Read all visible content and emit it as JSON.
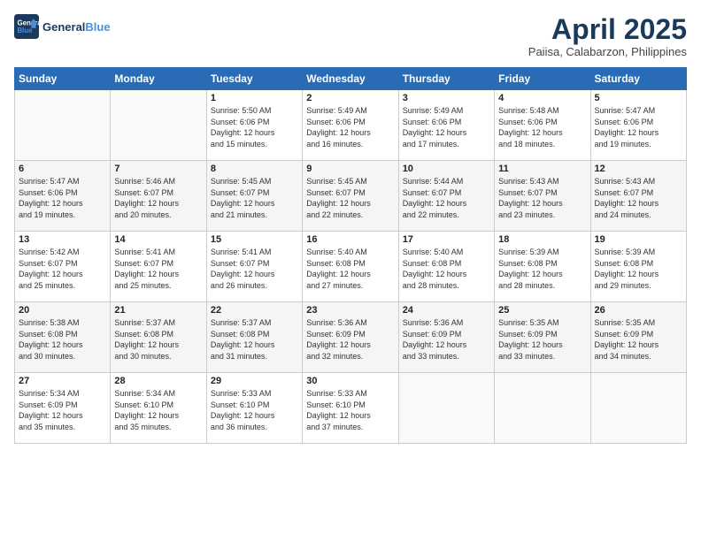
{
  "header": {
    "logo_line1": "General",
    "logo_line2": "Blue",
    "month_title": "April 2025",
    "subtitle": "Paiisa, Calabarzon, Philippines"
  },
  "days_of_week": [
    "Sunday",
    "Monday",
    "Tuesday",
    "Wednesday",
    "Thursday",
    "Friday",
    "Saturday"
  ],
  "weeks": [
    [
      {
        "day": "",
        "info": ""
      },
      {
        "day": "",
        "info": ""
      },
      {
        "day": "1",
        "info": "Sunrise: 5:50 AM\nSunset: 6:06 PM\nDaylight: 12 hours\nand 15 minutes."
      },
      {
        "day": "2",
        "info": "Sunrise: 5:49 AM\nSunset: 6:06 PM\nDaylight: 12 hours\nand 16 minutes."
      },
      {
        "day": "3",
        "info": "Sunrise: 5:49 AM\nSunset: 6:06 PM\nDaylight: 12 hours\nand 17 minutes."
      },
      {
        "day": "4",
        "info": "Sunrise: 5:48 AM\nSunset: 6:06 PM\nDaylight: 12 hours\nand 18 minutes."
      },
      {
        "day": "5",
        "info": "Sunrise: 5:47 AM\nSunset: 6:06 PM\nDaylight: 12 hours\nand 19 minutes."
      }
    ],
    [
      {
        "day": "6",
        "info": "Sunrise: 5:47 AM\nSunset: 6:06 PM\nDaylight: 12 hours\nand 19 minutes."
      },
      {
        "day": "7",
        "info": "Sunrise: 5:46 AM\nSunset: 6:07 PM\nDaylight: 12 hours\nand 20 minutes."
      },
      {
        "day": "8",
        "info": "Sunrise: 5:45 AM\nSunset: 6:07 PM\nDaylight: 12 hours\nand 21 minutes."
      },
      {
        "day": "9",
        "info": "Sunrise: 5:45 AM\nSunset: 6:07 PM\nDaylight: 12 hours\nand 22 minutes."
      },
      {
        "day": "10",
        "info": "Sunrise: 5:44 AM\nSunset: 6:07 PM\nDaylight: 12 hours\nand 22 minutes."
      },
      {
        "day": "11",
        "info": "Sunrise: 5:43 AM\nSunset: 6:07 PM\nDaylight: 12 hours\nand 23 minutes."
      },
      {
        "day": "12",
        "info": "Sunrise: 5:43 AM\nSunset: 6:07 PM\nDaylight: 12 hours\nand 24 minutes."
      }
    ],
    [
      {
        "day": "13",
        "info": "Sunrise: 5:42 AM\nSunset: 6:07 PM\nDaylight: 12 hours\nand 25 minutes."
      },
      {
        "day": "14",
        "info": "Sunrise: 5:41 AM\nSunset: 6:07 PM\nDaylight: 12 hours\nand 25 minutes."
      },
      {
        "day": "15",
        "info": "Sunrise: 5:41 AM\nSunset: 6:07 PM\nDaylight: 12 hours\nand 26 minutes."
      },
      {
        "day": "16",
        "info": "Sunrise: 5:40 AM\nSunset: 6:08 PM\nDaylight: 12 hours\nand 27 minutes."
      },
      {
        "day": "17",
        "info": "Sunrise: 5:40 AM\nSunset: 6:08 PM\nDaylight: 12 hours\nand 28 minutes."
      },
      {
        "day": "18",
        "info": "Sunrise: 5:39 AM\nSunset: 6:08 PM\nDaylight: 12 hours\nand 28 minutes."
      },
      {
        "day": "19",
        "info": "Sunrise: 5:39 AM\nSunset: 6:08 PM\nDaylight: 12 hours\nand 29 minutes."
      }
    ],
    [
      {
        "day": "20",
        "info": "Sunrise: 5:38 AM\nSunset: 6:08 PM\nDaylight: 12 hours\nand 30 minutes."
      },
      {
        "day": "21",
        "info": "Sunrise: 5:37 AM\nSunset: 6:08 PM\nDaylight: 12 hours\nand 30 minutes."
      },
      {
        "day": "22",
        "info": "Sunrise: 5:37 AM\nSunset: 6:08 PM\nDaylight: 12 hours\nand 31 minutes."
      },
      {
        "day": "23",
        "info": "Sunrise: 5:36 AM\nSunset: 6:09 PM\nDaylight: 12 hours\nand 32 minutes."
      },
      {
        "day": "24",
        "info": "Sunrise: 5:36 AM\nSunset: 6:09 PM\nDaylight: 12 hours\nand 33 minutes."
      },
      {
        "day": "25",
        "info": "Sunrise: 5:35 AM\nSunset: 6:09 PM\nDaylight: 12 hours\nand 33 minutes."
      },
      {
        "day": "26",
        "info": "Sunrise: 5:35 AM\nSunset: 6:09 PM\nDaylight: 12 hours\nand 34 minutes."
      }
    ],
    [
      {
        "day": "27",
        "info": "Sunrise: 5:34 AM\nSunset: 6:09 PM\nDaylight: 12 hours\nand 35 minutes."
      },
      {
        "day": "28",
        "info": "Sunrise: 5:34 AM\nSunset: 6:10 PM\nDaylight: 12 hours\nand 35 minutes."
      },
      {
        "day": "29",
        "info": "Sunrise: 5:33 AM\nSunset: 6:10 PM\nDaylight: 12 hours\nand 36 minutes."
      },
      {
        "day": "30",
        "info": "Sunrise: 5:33 AM\nSunset: 6:10 PM\nDaylight: 12 hours\nand 37 minutes."
      },
      {
        "day": "",
        "info": ""
      },
      {
        "day": "",
        "info": ""
      },
      {
        "day": "",
        "info": ""
      }
    ]
  ]
}
